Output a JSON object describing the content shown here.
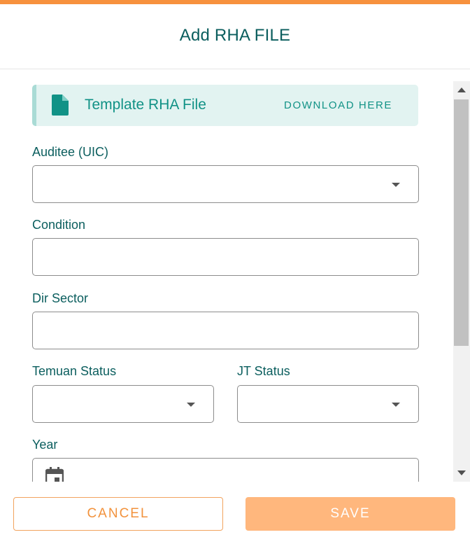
{
  "colors": {
    "accent_orange": "#f7913d",
    "primary_teal": "#0b5e5e",
    "template_bg": "#e2f3f1",
    "save_button_bg": "#ffb77d"
  },
  "dialog": {
    "title": "Add RHA FILE"
  },
  "template": {
    "icon": "file-icon",
    "label": "Template RHA File",
    "download_label": "DOWNLOAD HERE"
  },
  "form": {
    "auditee": {
      "label": "Auditee (UIC)",
      "value": "",
      "type": "select"
    },
    "condition": {
      "label": "Condition",
      "value": ""
    },
    "dir_sector": {
      "label": "Dir Sector",
      "value": ""
    },
    "temuan_status": {
      "label": "Temuan Status",
      "value": "",
      "type": "select"
    },
    "jt_status": {
      "label": "JT Status",
      "value": "",
      "type": "select"
    },
    "year": {
      "label": "Year",
      "value": "",
      "icon": "calendar-icon"
    }
  },
  "footer": {
    "cancel_label": "CANCEL",
    "save_label": "SAVE"
  }
}
